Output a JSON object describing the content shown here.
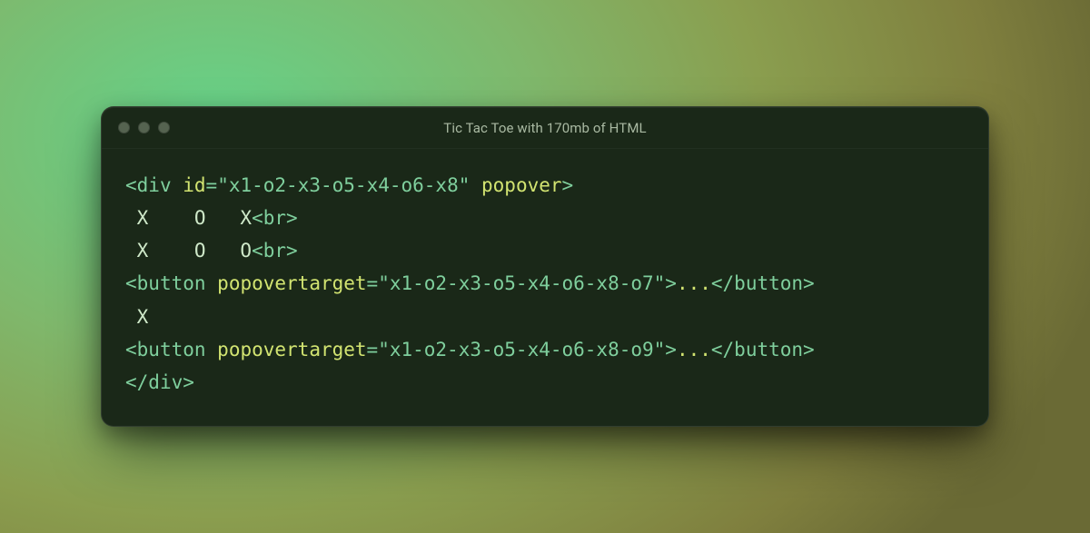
{
  "window": {
    "title": "Tic Tac Toe with 170mb of HTML"
  },
  "code": {
    "lines": [
      [
        {
          "cls": "t-punct",
          "text": "<"
        },
        {
          "cls": "t-tag",
          "text": "div"
        },
        {
          "cls": "t-plain",
          "text": " "
        },
        {
          "cls": "t-attr",
          "text": "id"
        },
        {
          "cls": "t-punct",
          "text": "="
        },
        {
          "cls": "t-str",
          "text": "\"x1-o2-x3-o5-x4-o6-x8\""
        },
        {
          "cls": "t-plain",
          "text": " "
        },
        {
          "cls": "t-attr",
          "text": "popover"
        },
        {
          "cls": "t-punct",
          "text": ">"
        }
      ],
      [
        {
          "cls": "t-plain",
          "text": " X    O   X"
        },
        {
          "cls": "t-punct",
          "text": "<"
        },
        {
          "cls": "t-tag",
          "text": "br"
        },
        {
          "cls": "t-punct",
          "text": ">"
        }
      ],
      [
        {
          "cls": "t-plain",
          "text": " X    O   O"
        },
        {
          "cls": "t-punct",
          "text": "<"
        },
        {
          "cls": "t-tag",
          "text": "br"
        },
        {
          "cls": "t-punct",
          "text": ">"
        }
      ],
      [
        {
          "cls": "t-punct",
          "text": "<"
        },
        {
          "cls": "t-tag",
          "text": "button"
        },
        {
          "cls": "t-plain",
          "text": " "
        },
        {
          "cls": "t-attr",
          "text": "popovertarget"
        },
        {
          "cls": "t-punct",
          "text": "="
        },
        {
          "cls": "t-str",
          "text": "\"x1-o2-x3-o5-x4-o6-x8-o7\""
        },
        {
          "cls": "t-punct",
          "text": ">"
        },
        {
          "cls": "t-content",
          "text": "..."
        },
        {
          "cls": "t-punct",
          "text": "</"
        },
        {
          "cls": "t-tag",
          "text": "button"
        },
        {
          "cls": "t-punct",
          "text": ">"
        }
      ],
      [
        {
          "cls": "t-plain",
          "text": " X"
        }
      ],
      [
        {
          "cls": "t-punct",
          "text": "<"
        },
        {
          "cls": "t-tag",
          "text": "button"
        },
        {
          "cls": "t-plain",
          "text": " "
        },
        {
          "cls": "t-attr",
          "text": "popovertarget"
        },
        {
          "cls": "t-punct",
          "text": "="
        },
        {
          "cls": "t-str",
          "text": "\"x1-o2-x3-o5-x4-o6-x8-o9\""
        },
        {
          "cls": "t-punct",
          "text": ">"
        },
        {
          "cls": "t-content",
          "text": "..."
        },
        {
          "cls": "t-punct",
          "text": "</"
        },
        {
          "cls": "t-tag",
          "text": "button"
        },
        {
          "cls": "t-punct",
          "text": ">"
        }
      ],
      [
        {
          "cls": "t-punct",
          "text": "</"
        },
        {
          "cls": "t-tag",
          "text": "div"
        },
        {
          "cls": "t-punct",
          "text": ">"
        }
      ]
    ]
  }
}
